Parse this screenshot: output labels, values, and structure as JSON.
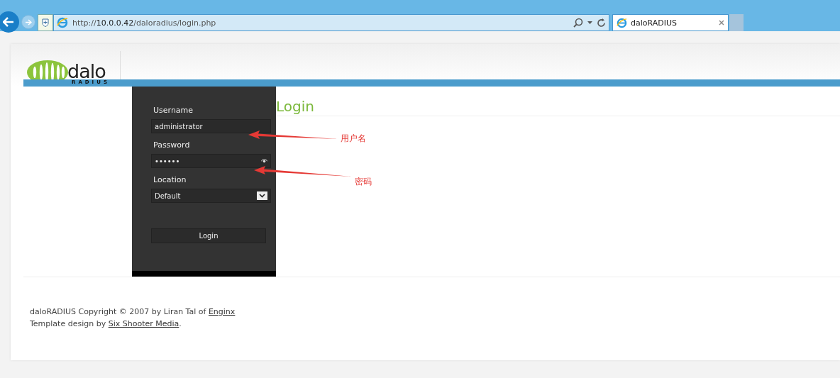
{
  "browser": {
    "address": "http://**10.0.0.42**/daloradius/login.php",
    "tab_title": "daloRADIUS"
  },
  "logo": {
    "word": "dalo",
    "subword": "RADIUS"
  },
  "login_form": {
    "fields": [
      {
        "label": "Username",
        "value": "administrator",
        "kind": "text"
      },
      {
        "label": "Password",
        "value": "••••••",
        "kind": "password"
      },
      {
        "label": "Location",
        "value": "Default",
        "kind": "select"
      }
    ],
    "button": "Login"
  },
  "heading": "Login",
  "annotations": [
    {
      "label": "用户名"
    },
    {
      "label": "密码"
    }
  ],
  "footer": [
    {
      "text": "daloRADIUS Copyright © 2007 by Liran Tal of ",
      "link": "Enginx"
    },
    {
      "text": "Template design by ",
      "link": "Six Shooter Media",
      "after": "."
    }
  ]
}
